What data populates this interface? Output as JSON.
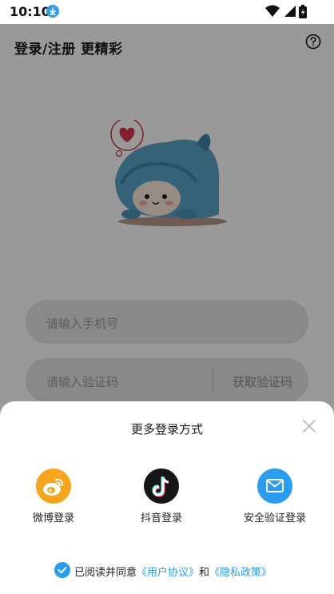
{
  "status_bar": {
    "time": "10:10"
  },
  "page": {
    "title": "登录/注册 更精彩",
    "phone_placeholder": "请输入手机号",
    "code_placeholder": "请输入验证码",
    "get_code_label": "获取验证码"
  },
  "sheet": {
    "title": "更多登录方式",
    "options": [
      {
        "label": "微博登录",
        "icon": "weibo-icon",
        "color": "#f6a51d"
      },
      {
        "label": "抖音登录",
        "icon": "douyin-icon",
        "color": "#161616"
      },
      {
        "label": "安全验证登录",
        "icon": "mail-icon",
        "color": "#2a9df0"
      }
    ],
    "agreement": {
      "prefix": "已阅读并同意",
      "user_agreement": "《用户协议》",
      "and": "和",
      "privacy_policy": "《隐私政策》",
      "checked": true
    }
  },
  "colors": {
    "accent": "#2a9df0",
    "overlay": "rgba(0,0,0,0.40)"
  }
}
